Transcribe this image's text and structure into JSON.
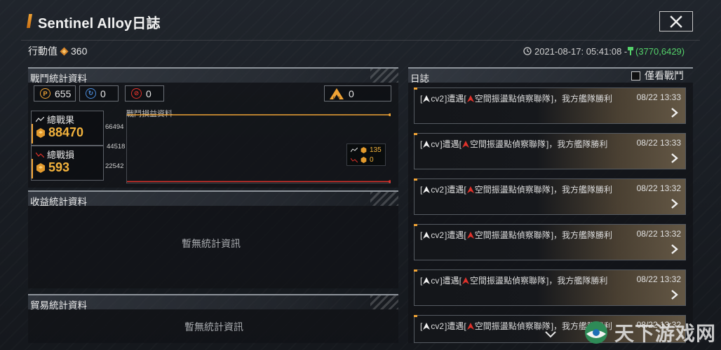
{
  "header": {
    "title": "Sentinel Alloy日誌",
    "close_icon": "close-icon"
  },
  "status": {
    "action_label": "行動值",
    "action_value": "360",
    "timestamp": "2021-08-17: 05:41:08 -",
    "gold_value": "(3770,6429)"
  },
  "battle_stats": {
    "title": "戰鬥統計資料",
    "counters": [
      {
        "icon": "p-coin-icon",
        "value": "655"
      },
      {
        "icon": "blue-refresh-icon",
        "value": "0"
      },
      {
        "icon": "red-ban-icon",
        "value": "0"
      },
      {
        "icon": "exp-icon",
        "value": "0"
      }
    ],
    "total_result_label": "總戰果",
    "total_result_value": "88470",
    "total_loss_label": "總戰損",
    "total_loss_value": "593",
    "chart_title": "戰鬥損益資料",
    "legend_top_value": "135",
    "legend_bottom_value": "0"
  },
  "chart_data": {
    "type": "line",
    "title": "戰鬥損益資料",
    "y_ticks": [
      "66494",
      "44518",
      "22542"
    ],
    "series": [
      {
        "values": [
          88470,
          88470
        ]
      },
      {
        "values": [
          593,
          593
        ]
      }
    ],
    "colors": [
      "#f0a335",
      "#e0322b"
    ]
  },
  "income_stats": {
    "title": "收益統計資料",
    "empty": "暫無統計資訊"
  },
  "trade_stats": {
    "title": "貿易統計資料",
    "empty": "暫無統計資訊"
  },
  "log": {
    "title": "日誌",
    "filter_label": "僅看戰鬥",
    "entries": [
      {
        "player": "cv2",
        "prefix": "[",
        "mid": "]遭遇[",
        "enemy": "空間振盪點偵察聯隊",
        "suffix": "]，我方艦隊勝利",
        "date": "08/22 13:33"
      },
      {
        "player": "cv",
        "prefix": "[",
        "mid": "]遭遇[",
        "enemy": "空間振盪點偵察聯隊",
        "suffix": "]，我方艦隊勝利",
        "date": "08/22 13:33"
      },
      {
        "player": "cv2",
        "prefix": "[",
        "mid": "]遭遇[",
        "enemy": "空間振盪點偵察聯隊",
        "suffix": "]，我方艦隊勝利",
        "date": "08/22 13:32"
      },
      {
        "player": "cv2",
        "prefix": "[",
        "mid": "]遭遇[",
        "enemy": "空間振盪點偵察聯隊",
        "suffix": "]，我方艦隊勝利",
        "date": "08/22 13:32"
      },
      {
        "player": "cv",
        "prefix": "[",
        "mid": "]遭遇[",
        "enemy": "空間振盪點偵察聯隊",
        "suffix": "]，我方艦隊勝利",
        "date": "08/22 13:32"
      },
      {
        "player": "cv2",
        "prefix": "[",
        "mid": "]遭遇[",
        "enemy": "空間振盪點偵察聯隊",
        "suffix": "]，我方艦隊勝利",
        "date": "08/22 13:32"
      }
    ]
  },
  "watermark": {
    "text": "天下游戏网"
  },
  "colors": {
    "accent": "#f0a335",
    "gold_text": "#f3b33d",
    "loss_red": "#e0322b",
    "green": "#54d16a"
  }
}
